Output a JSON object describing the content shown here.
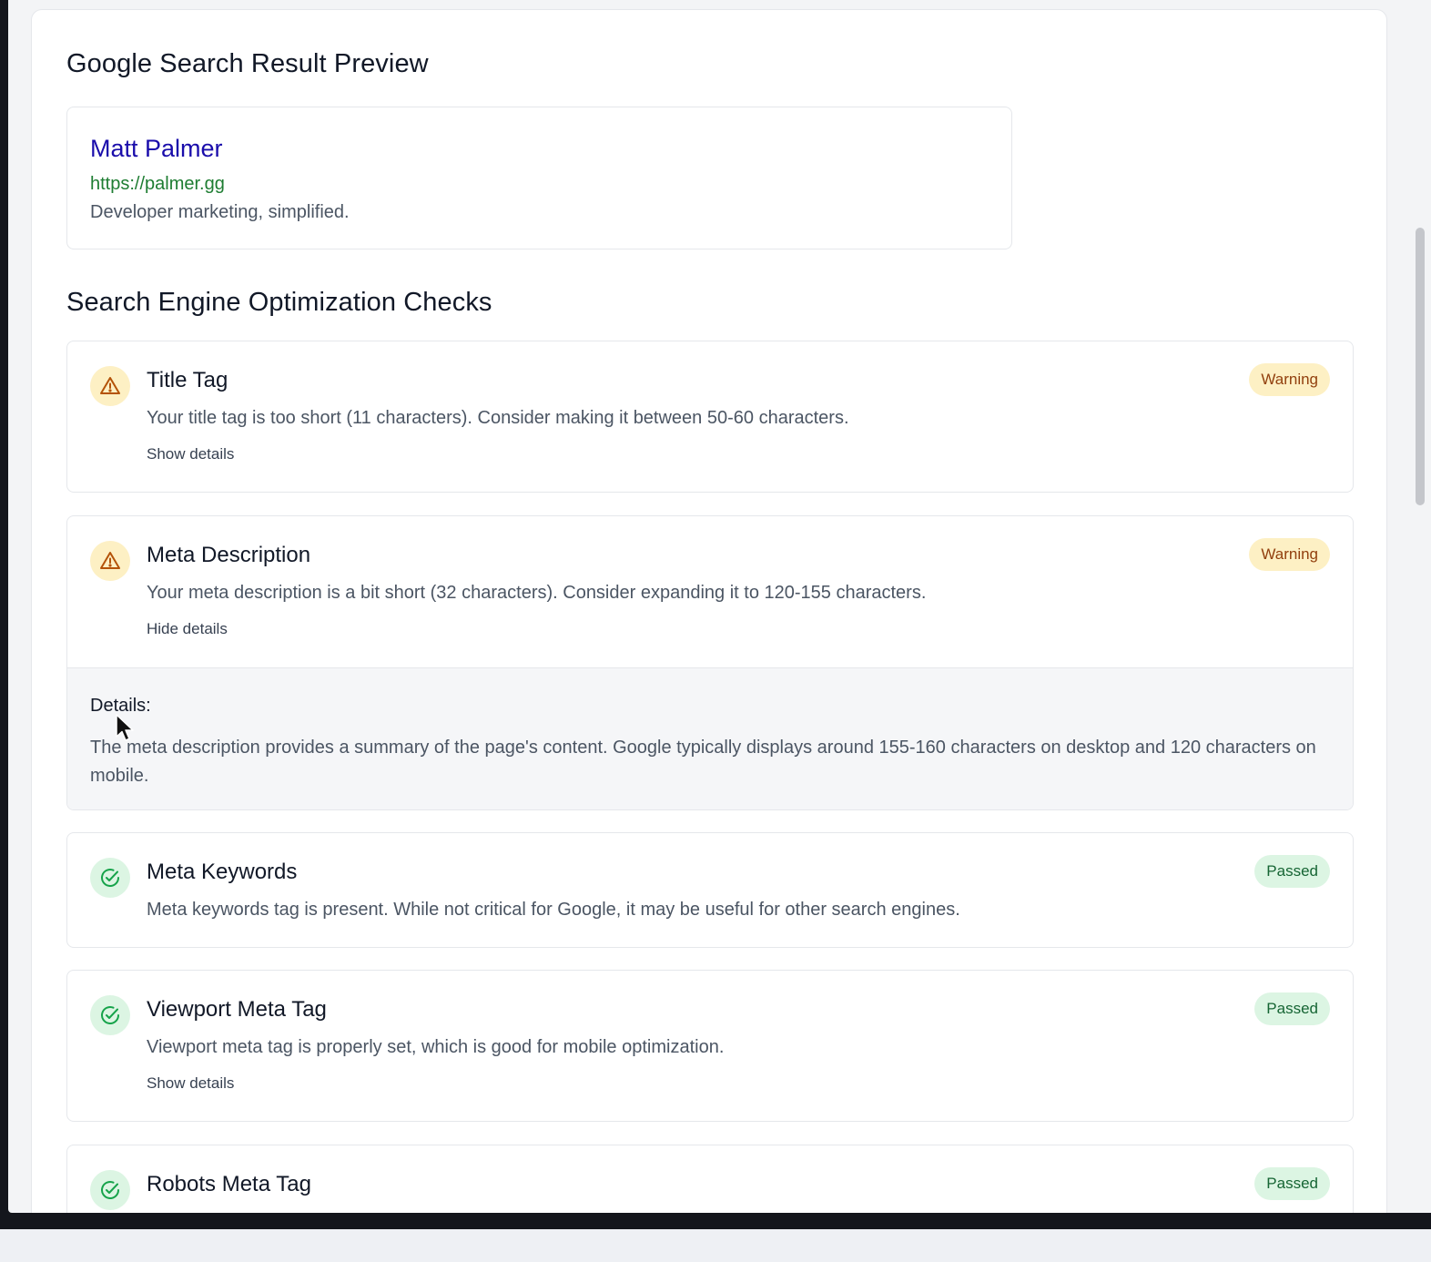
{
  "preview": {
    "heading": "Google Search Result Preview",
    "result_title": "Matt Palmer",
    "result_url": "https://palmer.gg",
    "result_description": "Developer marketing, simplified."
  },
  "checks_heading": "Search Engine Optimization Checks",
  "checks": [
    {
      "title": "Title Tag",
      "status": "Warning",
      "icon": "warning-triangle-icon",
      "description": "Your title tag is too short (11 characters). Consider making it between 50-60 characters.",
      "toggle_label": "Show details"
    },
    {
      "title": "Meta Description",
      "status": "Warning",
      "icon": "warning-triangle-icon",
      "description": "Your meta description is a bit short (32 characters). Consider expanding it to 120-155 characters.",
      "toggle_label": "Hide details",
      "details_heading": "Details:",
      "details_text": "The meta description provides a summary of the page's content. Google typically displays around 155-160 characters on desktop and 120 characters on mobile."
    },
    {
      "title": "Meta Keywords",
      "status": "Passed",
      "icon": "check-circle-icon",
      "description": "Meta keywords tag is present. While not critical for Google, it may be useful for other search engines."
    },
    {
      "title": "Viewport Meta Tag",
      "status": "Passed",
      "icon": "check-circle-icon",
      "description": "Viewport meta tag is properly set, which is good for mobile optimization.",
      "toggle_label": "Show details"
    },
    {
      "title": "Robots Meta Tag",
      "status": "Passed",
      "icon": "check-circle-icon"
    }
  ],
  "colors": {
    "warning_bg": "#fdf0c4",
    "warning_fg": "#b45309",
    "passed_bg": "#dcf5e3",
    "passed_fg": "#16a34a",
    "link_title": "#1a0dab",
    "link_url": "#1e7d32"
  }
}
